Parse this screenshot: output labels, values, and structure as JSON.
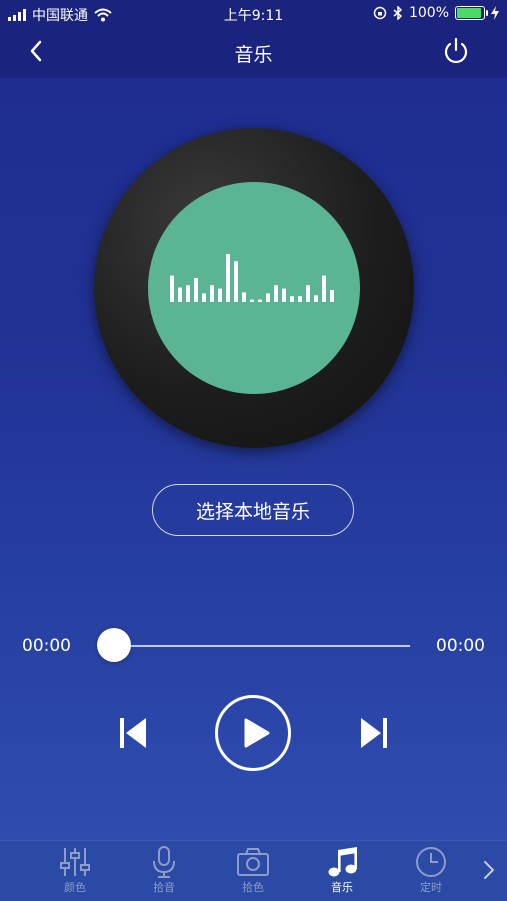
{
  "status_bar": {
    "carrier": "中国联通",
    "time": "上午9:11",
    "battery": "100%",
    "battery_level": 1.0
  },
  "header": {
    "title": "音乐",
    "back_icon": "chevron-left-icon",
    "power_icon": "power-icon"
  },
  "player": {
    "select_label": "选择本地音乐",
    "elapsed": "00:00",
    "duration": "00:00",
    "progress": 0,
    "equalizer_levels": [
      0.55,
      0.3,
      0.35,
      0.5,
      0.18,
      0.35,
      0.28,
      1.0,
      0.85,
      0.2,
      0.05,
      0.05,
      0.18,
      0.35,
      0.28,
      0.12,
      0.12,
      0.35,
      0.14,
      0.55,
      0.25
    ]
  },
  "tabs": [
    {
      "label": "颜色",
      "icon": "sliders-icon",
      "active": false
    },
    {
      "label": "拾音",
      "icon": "microphone-icon",
      "active": false
    },
    {
      "label": "拾色",
      "icon": "camera-icon",
      "active": false
    },
    {
      "label": "音乐",
      "icon": "music-note-icon",
      "active": true
    },
    {
      "label": "定时",
      "icon": "clock-icon",
      "active": false
    }
  ],
  "colors": {
    "header_bg": "#1a237e",
    "record_label": "#5bb593",
    "accent": "#ffffff"
  }
}
